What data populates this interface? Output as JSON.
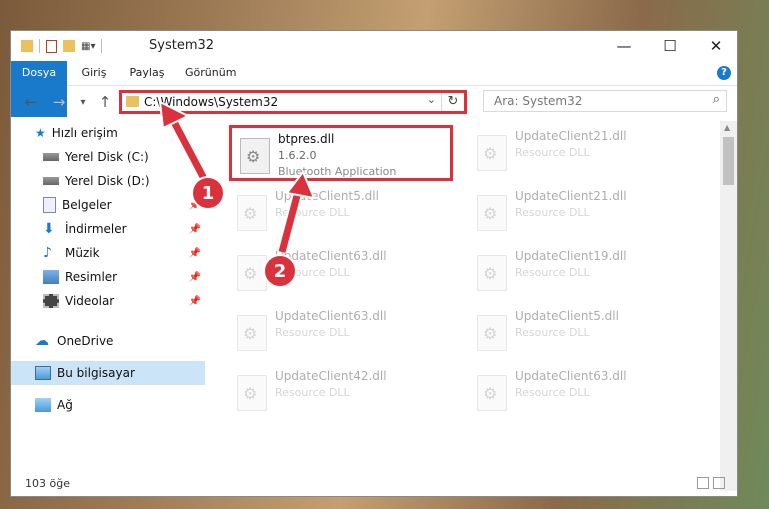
{
  "window": {
    "title": "System32",
    "minimize": "—",
    "maximize": "☐",
    "close": "✕"
  },
  "ribbon": {
    "tabs": [
      "Dosya",
      "Giriş",
      "Paylaş",
      "Görünüm"
    ],
    "help": "?"
  },
  "nav": {
    "back": "←",
    "forward": "→",
    "recent": "▾",
    "up": "↑"
  },
  "address": {
    "path": "C:\\Windows\\System32",
    "dropdown": "⌄",
    "refresh": "↻"
  },
  "search": {
    "placeholder": "Ara: System32",
    "icon": "⌕"
  },
  "sidebar": {
    "items": [
      {
        "label": "Hızlı erişim",
        "icon": "star-icon"
      },
      {
        "label": "Yerel Disk (C:)",
        "icon": "drive-icon"
      },
      {
        "label": "Yerel Disk (D:)",
        "icon": "drive-icon"
      },
      {
        "label": "Belgeler",
        "icon": "document-icon"
      },
      {
        "label": "İndirmeler",
        "icon": "download-icon"
      },
      {
        "label": "Müzik",
        "icon": "music-icon"
      },
      {
        "label": "Resimler",
        "icon": "picture-icon"
      },
      {
        "label": "Videolar",
        "icon": "video-icon"
      },
      {
        "label": "OneDrive",
        "icon": "cloud-icon"
      },
      {
        "label": "Bu bilgisayar",
        "icon": "computer-icon"
      },
      {
        "label": "Ağ",
        "icon": "network-icon"
      }
    ]
  },
  "files": [
    {
      "name": "btpres.dll",
      "version": "1.6.2.0",
      "desc": "Bluetooth Application"
    },
    {
      "name": "UpdateClient21.dll",
      "version": "",
      "desc": "Resource DLL"
    },
    {
      "name": "UpdateClient5.dll",
      "version": "",
      "desc": "Resource DLL"
    },
    {
      "name": "UpdateClient21.dll",
      "version": "",
      "desc": "Resource DLL"
    },
    {
      "name": "UpdateClient63.dll",
      "version": "",
      "desc": "Resource DLL"
    },
    {
      "name": "UpdateClient19.dll",
      "version": "",
      "desc": "Resource DLL"
    },
    {
      "name": "UpdateClient63.dll",
      "version": "",
      "desc": "Resource DLL"
    },
    {
      "name": "UpdateClient5.dll",
      "version": "",
      "desc": "Resource DLL"
    },
    {
      "name": "UpdateClient42.dll",
      "version": "",
      "desc": "Resource DLL"
    },
    {
      "name": "UpdateClient63.dll",
      "version": "",
      "desc": "Resource DLL"
    }
  ],
  "status": {
    "count": "103 öğe"
  },
  "annotations": {
    "one": "1",
    "two": "2"
  },
  "colors": {
    "accent": "#1979ca",
    "highlight": "#d9323c"
  }
}
